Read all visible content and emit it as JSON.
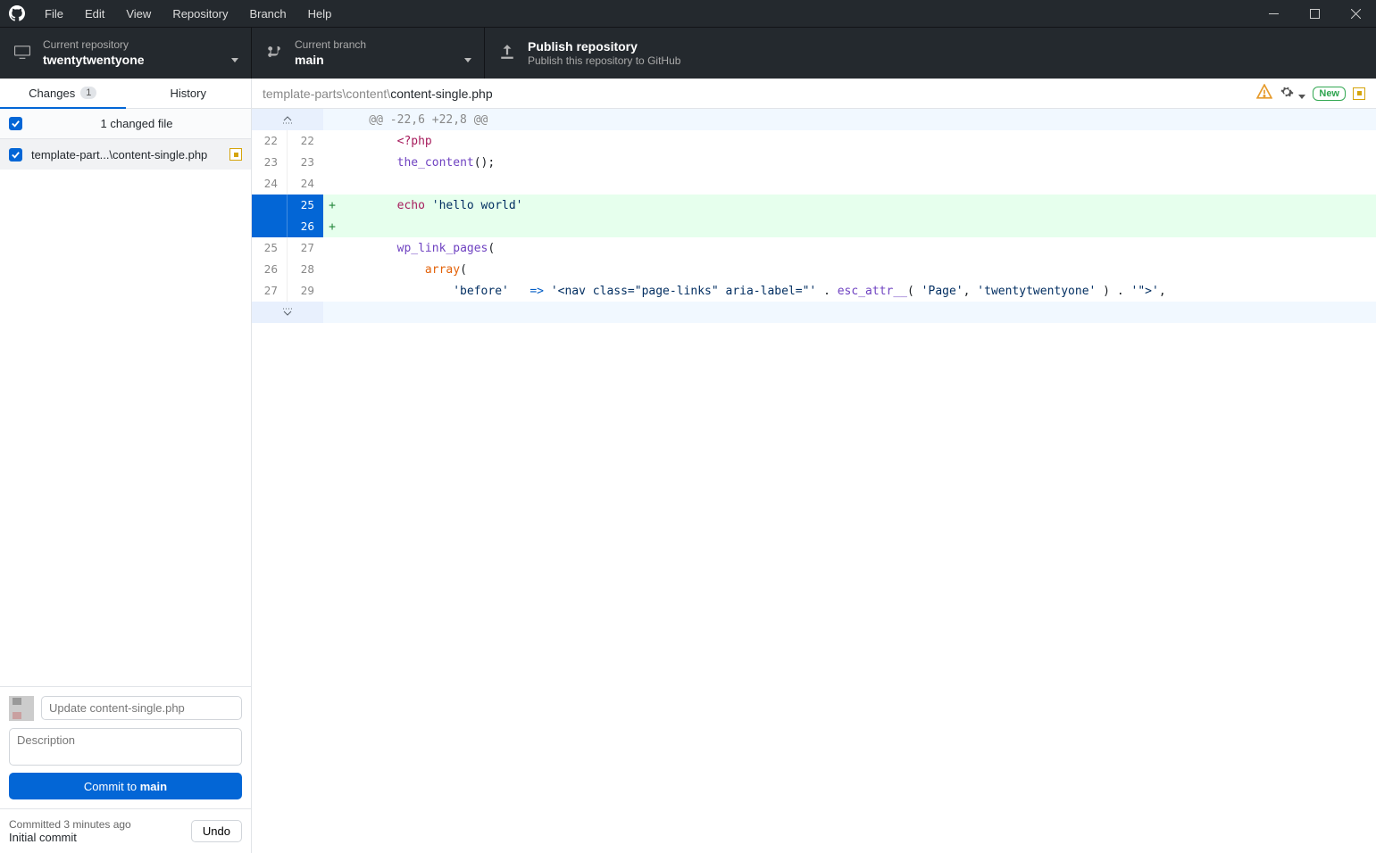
{
  "menu": {
    "items": [
      "File",
      "Edit",
      "View",
      "Repository",
      "Branch",
      "Help"
    ]
  },
  "toolbar": {
    "repo": {
      "label": "Current repository",
      "value": "twentytwentyone"
    },
    "branch": {
      "label": "Current branch",
      "value": "main"
    },
    "publish": {
      "title": "Publish repository",
      "subtitle": "Publish this repository to GitHub"
    }
  },
  "sidebar": {
    "tabs": {
      "changes": "Changes",
      "changes_count": "1",
      "history": "History"
    },
    "summary": {
      "label": "1 changed file"
    },
    "files": [
      {
        "name": "template-part...\\content-single.php"
      }
    ]
  },
  "commit": {
    "summary_placeholder": "Update content-single.php",
    "description_placeholder": "Description",
    "button_prefix": "Commit to ",
    "button_branch": "main",
    "last_time": "Committed 3 minutes ago",
    "last_msg": "Initial commit",
    "undo_label": "Undo"
  },
  "diff": {
    "breadcrumb_prefix": "template-parts\\content\\",
    "breadcrumb_file": "content-single.php",
    "new_label": "New",
    "lines": [
      {
        "kind": "hunk",
        "old": "",
        "new": "",
        "tokens": [
          [
            "plain",
            "    @@ -22,6 +22,8 @@"
          ]
        ]
      },
      {
        "kind": "ctx",
        "old": "22",
        "new": "22",
        "tokens": [
          [
            "plain",
            "        "
          ],
          [
            "t-kw",
            "<?php"
          ]
        ]
      },
      {
        "kind": "ctx",
        "old": "23",
        "new": "23",
        "tokens": [
          [
            "plain",
            "        "
          ],
          [
            "t-fn",
            "the_content"
          ],
          [
            "plain",
            "();"
          ]
        ]
      },
      {
        "kind": "ctx",
        "old": "24",
        "new": "24",
        "tokens": []
      },
      {
        "kind": "add",
        "old": "",
        "new": "25",
        "tokens": [
          [
            "plain",
            "        "
          ],
          [
            "t-kw",
            "echo "
          ],
          [
            "t-str",
            "'hello world'"
          ]
        ]
      },
      {
        "kind": "add",
        "old": "",
        "new": "26",
        "tokens": []
      },
      {
        "kind": "ctx",
        "old": "25",
        "new": "27",
        "tokens": [
          [
            "plain",
            "        "
          ],
          [
            "t-fn",
            "wp_link_pages"
          ],
          [
            "plain",
            "("
          ]
        ]
      },
      {
        "kind": "ctx",
        "old": "26",
        "new": "28",
        "tokens": [
          [
            "plain",
            "            "
          ],
          [
            "t-orange",
            "array"
          ],
          [
            "plain",
            "("
          ]
        ]
      },
      {
        "kind": "ctx",
        "old": "27",
        "new": "29",
        "tokens": [
          [
            "plain",
            "                "
          ],
          [
            "t-str",
            "'before'"
          ],
          [
            "plain",
            "   "
          ],
          [
            "t-op",
            "=>"
          ],
          [
            "plain",
            " "
          ],
          [
            "t-str",
            "'<nav class=\"page-links\" aria-label=\"'"
          ],
          [
            "plain",
            " . "
          ],
          [
            "t-fn",
            "esc_attr__"
          ],
          [
            "plain",
            "( "
          ],
          [
            "t-str",
            "'Page'"
          ],
          [
            "plain",
            ", "
          ],
          [
            "t-str",
            "'twentytwentyone'"
          ],
          [
            "plain",
            " ) . "
          ],
          [
            "t-str",
            "'\">'"
          ],
          [
            "plain",
            ","
          ]
        ]
      },
      {
        "kind": "hunk-tail",
        "old": "",
        "new": "",
        "tokens": []
      }
    ]
  }
}
